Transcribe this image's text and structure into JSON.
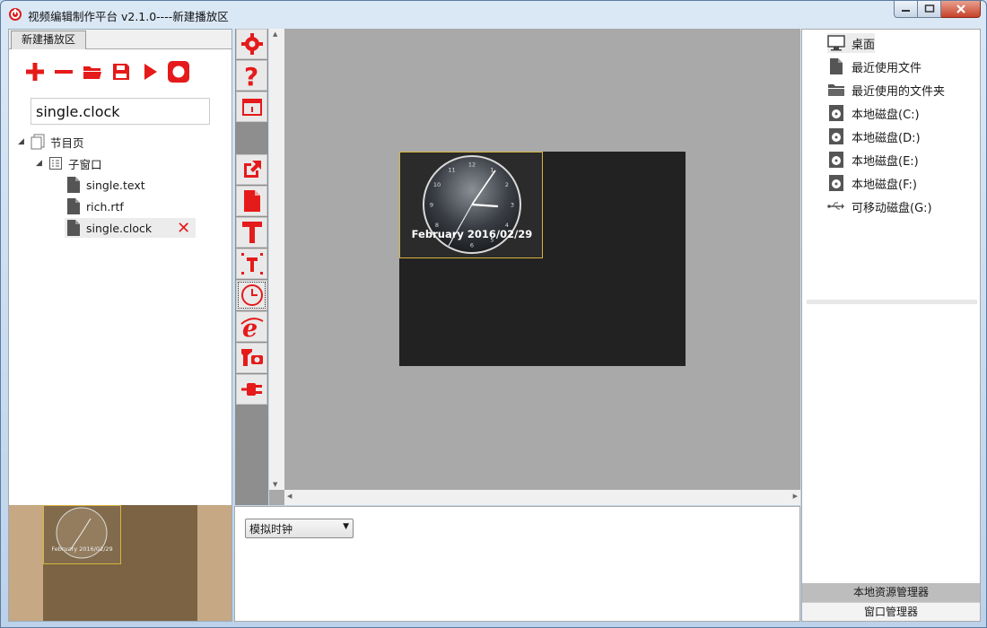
{
  "window": {
    "title": "视频编辑制作平台 v2.1.0----新建播放区",
    "controls": [
      "minimize",
      "maximize",
      "close"
    ]
  },
  "left_panel": {
    "tab_label": "新建播放区",
    "toolbar_icons": [
      "add-icon",
      "remove-icon",
      "open-folder-icon",
      "save-icon",
      "play-icon",
      "stop-icon"
    ],
    "program_name_value": "single.clock",
    "tree": {
      "page": "节目页",
      "subwindow": "子窗口",
      "items": [
        "single.text",
        "rich.rtf",
        "single.clock"
      ]
    },
    "preview_date": "February 2016/02/29"
  },
  "tool_column": {
    "icons": [
      "settings-icon",
      "help-icon",
      "window-icon",
      "export-icon",
      "file-icon",
      "text-icon",
      "text-box-icon",
      "clock-icon",
      "browser-icon",
      "camera-icon",
      "plugin-icon"
    ]
  },
  "canvas": {
    "clock_date": "February 2016/02/29",
    "clock_numbers": [
      "12",
      "1",
      "2",
      "3",
      "4",
      "5",
      "6",
      "7",
      "8",
      "9",
      "10",
      "11"
    ]
  },
  "properties": {
    "clock_type_selected": "模拟时钟"
  },
  "right_panel": {
    "items": [
      {
        "label": "桌面",
        "icon": "desktop-icon"
      },
      {
        "label": "最近使用文件",
        "icon": "file-icon"
      },
      {
        "label": "最近使用的文件夹",
        "icon": "folder-icon"
      },
      {
        "label": "本地磁盘(C:)",
        "icon": "disk-icon"
      },
      {
        "label": "本地磁盘(D:)",
        "icon": "disk-icon"
      },
      {
        "label": "本地磁盘(E:)",
        "icon": "disk-icon"
      },
      {
        "label": "本地磁盘(F:)",
        "icon": "disk-icon"
      },
      {
        "label": "可移动磁盘(G:)",
        "icon": "usb-icon"
      }
    ],
    "tabs": [
      "本地资源管理器",
      "窗口管理器"
    ]
  },
  "colors": {
    "accent_red": "#e51a1a",
    "selection_border": "#d7b43e",
    "canvas_bg": "#a9a9a9",
    "screen_bg": "#222222"
  }
}
